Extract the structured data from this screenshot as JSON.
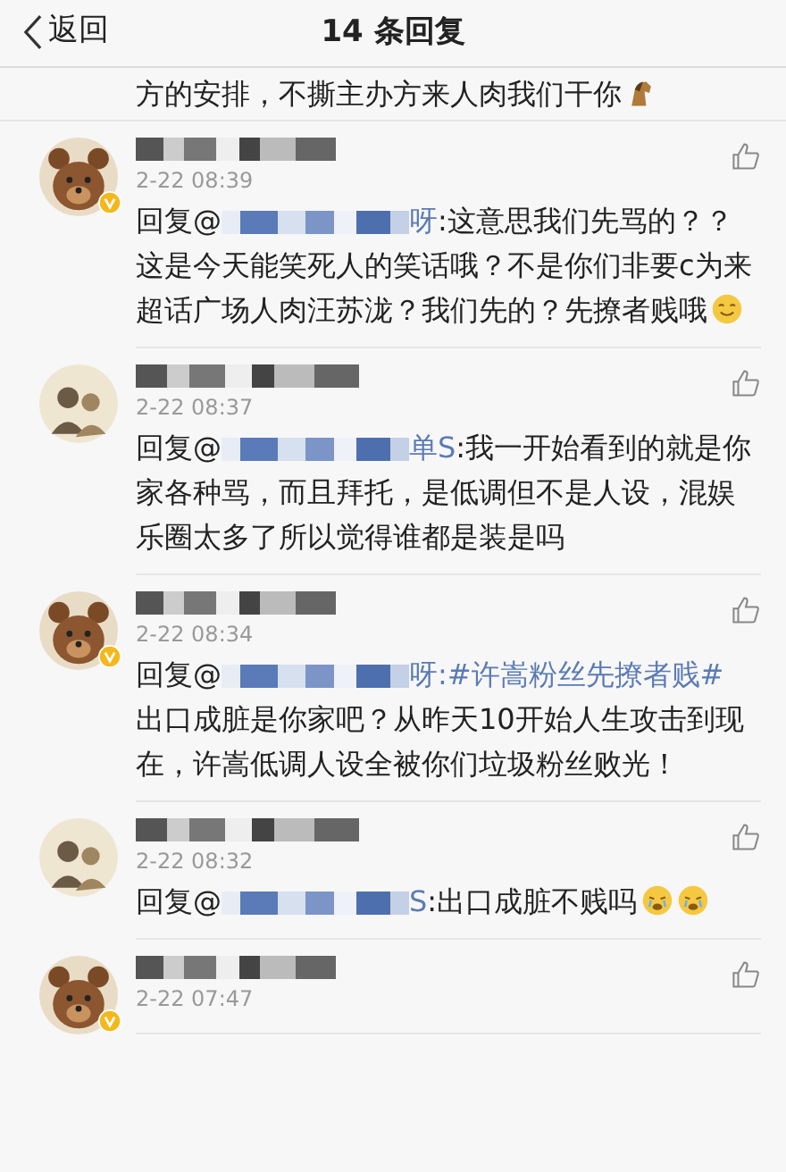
{
  "header": {
    "back_label": "返回",
    "title": "14 条回复"
  },
  "top_fragment": {
    "text": "方的安排，不撕主办方来人肉我们干你",
    "emojis": [
      {
        "kind": "horse"
      }
    ]
  },
  "comments": [
    {
      "avatar": {
        "kind": "bear",
        "verified": true
      },
      "time": "2-22 08:39",
      "reply_prefix": "回复@",
      "mention_tail": "呀",
      "text": ":这意思我们先骂的？？这是今天能笑死人的笑话哦？不是你们非要c为来超话广场人肉汪苏泷？我们先的？先撩者贱哦",
      "emojis": [
        {
          "kind": "smile"
        }
      ]
    },
    {
      "avatar": {
        "kind": "photo",
        "verified": false
      },
      "time": "2-22 08:37",
      "reply_prefix": "回复@",
      "mention_tail": "单S",
      "text": ":我一开始看到的就是你家各种骂，而且拜托，是低调但不是人设，混娱乐圈太多了所以觉得谁都是装是吗"
    },
    {
      "avatar": {
        "kind": "bear",
        "verified": true
      },
      "time": "2-22 08:34",
      "reply_prefix": "回复@",
      "mention_tail": "呀",
      "hashtag": ":#许嵩粉丝先撩者贱#",
      "text": " 出口成脏是你家吧？从昨天10开始人生攻击到现在，许嵩低调人设全被你们垃圾粉丝败光！"
    },
    {
      "avatar": {
        "kind": "photo",
        "verified": false
      },
      "time": "2-22 08:32",
      "reply_prefix": "回复@",
      "mention_tail": "S",
      "text": ":出口成脏不贱吗",
      "emojis": [
        {
          "kind": "cry"
        },
        {
          "kind": "cry"
        }
      ]
    },
    {
      "avatar": {
        "kind": "bear",
        "verified": true
      },
      "time": "2-22 07:47"
    }
  ]
}
